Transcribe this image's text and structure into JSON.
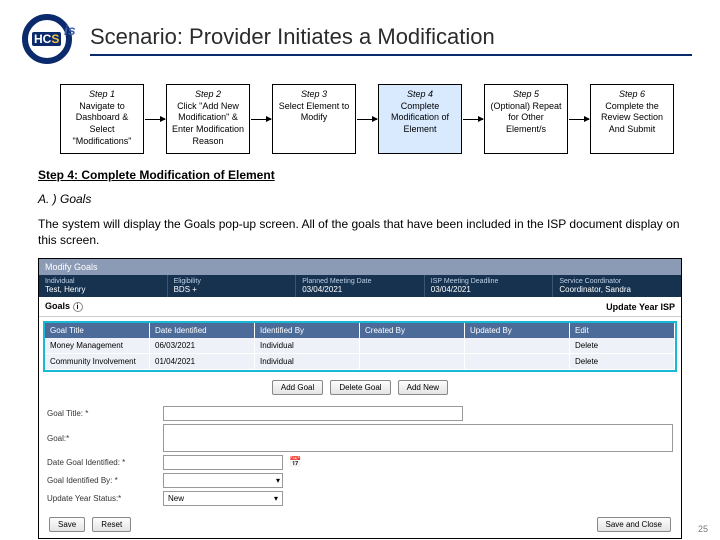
{
  "header": {
    "logo_hc": "HC",
    "logo_s": "S",
    "logo_is": "is",
    "title": "Scenario: Provider Initiates a Modification"
  },
  "flow": {
    "steps": [
      {
        "title": "Step 1",
        "desc": "Navigate to Dashboard & Select \"Modifications\"",
        "current": false
      },
      {
        "title": "Step 2",
        "desc": "Click \"Add New Modification\" & Enter Modification Reason",
        "current": false
      },
      {
        "title": "Step 3",
        "desc": "Select Element to Modify",
        "current": false
      },
      {
        "title": "Step 4",
        "desc": "Complete Modification of Element",
        "current": true
      },
      {
        "title": "Step 5",
        "desc": "(Optional) Repeat for Other Element/s",
        "current": false
      },
      {
        "title": "Step 6",
        "desc": "Complete the Review Section And Submit",
        "current": false
      }
    ]
  },
  "section": {
    "heading": "Step 4: Complete Modification of Element",
    "sub": "A. ) Goals",
    "body": "The system will display the Goals pop-up screen. All of the goals that have been included in the ISP document display on this screen."
  },
  "shot": {
    "bar": "Modify Goals",
    "info": {
      "c1_label": "Individual",
      "c1_value": "Test, Henry",
      "c2_label": "Eligibility",
      "c2_value": "BDS +",
      "c3_label": "Planned Meeting Date",
      "c3_value": "03/04/2021",
      "c4_label": "ISP Meeting Deadline",
      "c4_value": "03/04/2021",
      "c5_label": "Service Coordinator",
      "c5_value": "Coordinator, Sandra"
    },
    "goals_label": "Goals",
    "goals_btn": "Update Year ISP",
    "grid_head": [
      "Goal Title",
      "Date Identified",
      "Identified By",
      "Created By",
      "Updated By",
      "Edit"
    ],
    "grid_rows": [
      [
        "Money Management",
        "06/03/2021",
        "Individual",
        "",
        "",
        "Delete"
      ],
      [
        "Community Involvement",
        "01/04/2021",
        "Individual",
        "",
        "",
        "Delete"
      ]
    ],
    "mid_buttons": [
      "Add Goal",
      "Delete Goal",
      "Add New"
    ],
    "form": {
      "goal_title_label": "Goal Title: *",
      "goal_label": "Goal:*",
      "date_label": "Date Goal Identified: *",
      "idby_label": "Goal Identified By: *",
      "status_label": "Update Year Status:*",
      "status_value": "New",
      "dropdown_caret": "▾"
    },
    "bottom_left": [
      "Save",
      "Reset"
    ],
    "bottom_right": "Save and Close"
  },
  "page_num": "25"
}
